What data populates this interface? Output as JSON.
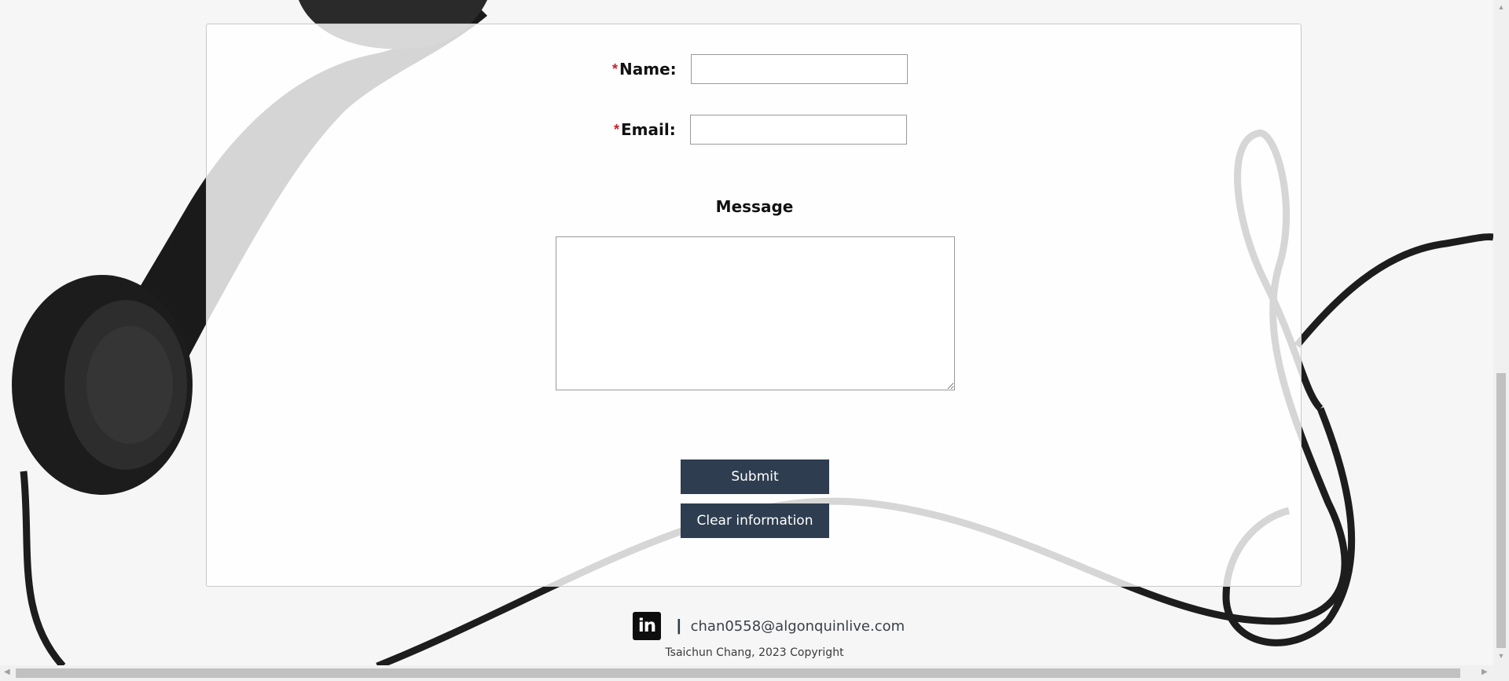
{
  "form": {
    "name_label": "Name:",
    "email_label": "Email:",
    "required_marker": "*",
    "name_value": "",
    "email_value": "",
    "message_label": "Message",
    "message_value": "",
    "submit_label": "Submit",
    "clear_label": "Clear information"
  },
  "footer": {
    "linkedin_icon_text": "in",
    "separator": "|",
    "email": "chan0558@algonquinlive.com",
    "copyright": "Tsaichun Chang, 2023 Copyright"
  },
  "colors": {
    "button_bg": "#2e3d4f",
    "required": "#c0262b"
  },
  "icons": {
    "linkedin": "linkedin-icon",
    "resize": "resize-handle-icon"
  }
}
